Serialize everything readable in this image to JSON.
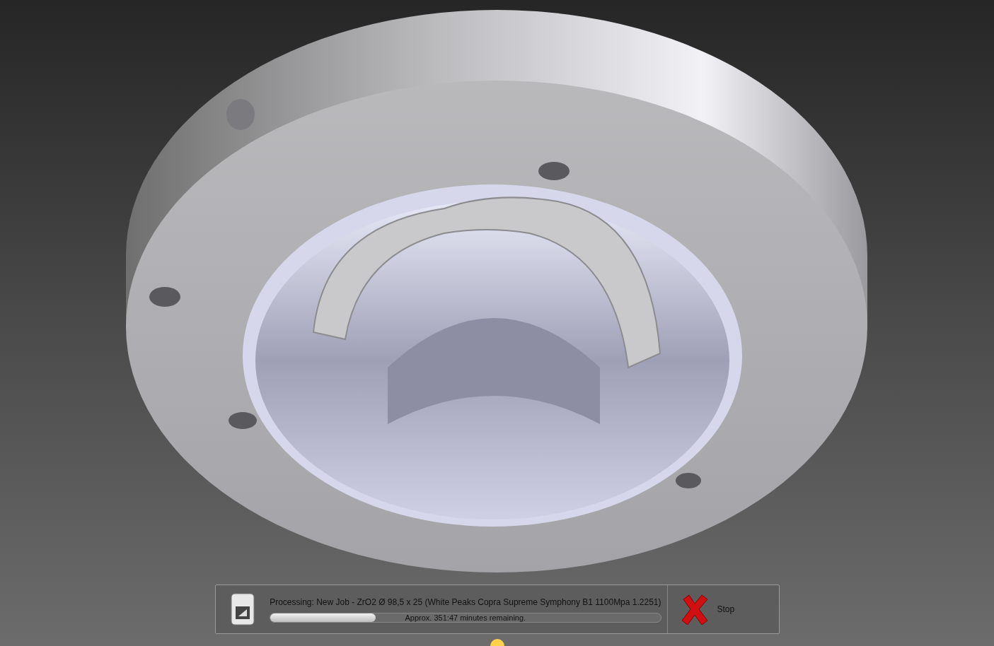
{
  "progress_panel": {
    "status": "Processing: New Job - ZrO2 Ø 98,5 x 25 (White Peaks Copra Supreme Symphony B1 1100Mpa 1.2251)",
    "level": 0.27,
    "remaining": "Approx. 351:47 minutes remaining.",
    "stop_label": "Stop"
  }
}
